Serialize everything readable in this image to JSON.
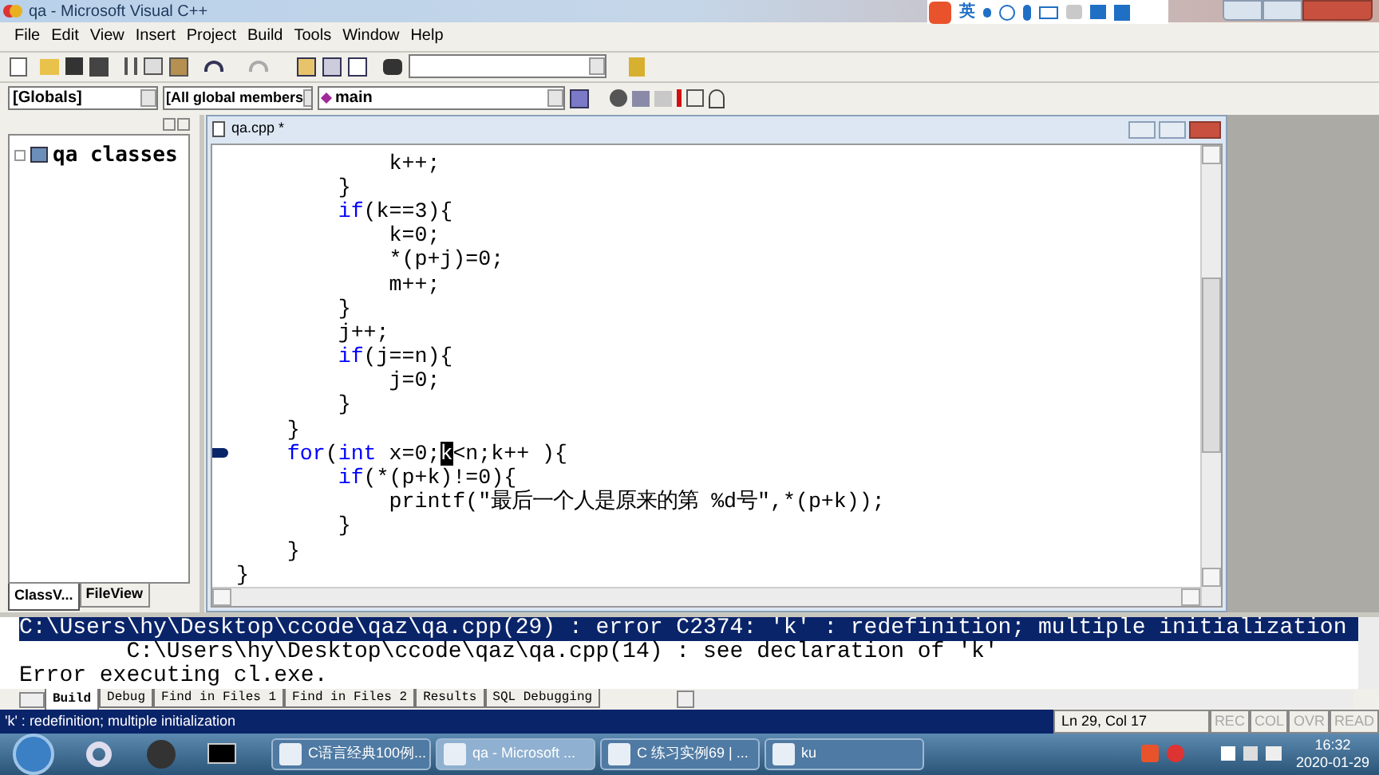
{
  "window": {
    "title": "qa - Microsoft Visual C++"
  },
  "ime_bar": {
    "label": "英"
  },
  "menu": [
    "File",
    "Edit",
    "View",
    "Insert",
    "Project",
    "Build",
    "Tools",
    "Window",
    "Help"
  ],
  "toolbar": {
    "scope_combo": {
      "value": "[Globals]"
    },
    "members_combo": {
      "value": "[All global members"
    },
    "function_combo": {
      "value": "main"
    }
  },
  "workspace": {
    "tree": [
      {
        "label": "qa classes",
        "expanded": false
      }
    ],
    "tabs": [
      {
        "label": "ClassV...",
        "selected": true
      },
      {
        "label": "FileView",
        "selected": false
      }
    ]
  },
  "editor": {
    "title": "qa.cpp *",
    "lines": [
      {
        "current": false,
        "segments": [
          {
            "kind": "text",
            "text": "            k++;"
          }
        ]
      },
      {
        "current": false,
        "segments": [
          {
            "kind": "text",
            "text": "        }"
          }
        ]
      },
      {
        "current": false,
        "segments": [
          {
            "kind": "keyword",
            "text": "        if"
          },
          {
            "kind": "text",
            "text": "(k==3){"
          }
        ]
      },
      {
        "current": false,
        "segments": [
          {
            "kind": "text",
            "text": "            k=0;"
          }
        ]
      },
      {
        "current": false,
        "segments": [
          {
            "kind": "text",
            "text": "            *(p+j)=0;"
          }
        ]
      },
      {
        "current": false,
        "segments": [
          {
            "kind": "text",
            "text": "            m++;"
          }
        ]
      },
      {
        "current": false,
        "segments": [
          {
            "kind": "text",
            "text": "        }"
          }
        ]
      },
      {
        "current": false,
        "segments": [
          {
            "kind": "text",
            "text": "        j++;"
          }
        ]
      },
      {
        "current": false,
        "segments": [
          {
            "kind": "keyword",
            "text": "        if"
          },
          {
            "kind": "text",
            "text": "(j==n){"
          }
        ]
      },
      {
        "current": false,
        "segments": [
          {
            "kind": "text",
            "text": "            j=0;"
          }
        ]
      },
      {
        "current": false,
        "segments": [
          {
            "kind": "text",
            "text": "        }"
          }
        ]
      },
      {
        "current": false,
        "segments": [
          {
            "kind": "text",
            "text": "    }"
          }
        ]
      },
      {
        "current": true,
        "segments": [
          {
            "kind": "keyword",
            "text": "    for"
          },
          {
            "kind": "text",
            "text": "("
          },
          {
            "kind": "keyword",
            "text": "int"
          },
          {
            "kind": "text",
            "text": " x=0;"
          },
          {
            "kind": "selected",
            "text": "k"
          },
          {
            "kind": "text",
            "text": "<n;k++ ){"
          }
        ]
      },
      {
        "current": false,
        "segments": [
          {
            "kind": "keyword",
            "text": "        if"
          },
          {
            "kind": "text",
            "text": "(*(p+k)!=0){"
          }
        ]
      },
      {
        "current": false,
        "segments": [
          {
            "kind": "text",
            "text": "            printf(\"最后一个人是原来的第 %d号\",*(p+k));"
          }
        ]
      },
      {
        "current": false,
        "segments": [
          {
            "kind": "text",
            "text": "        }"
          }
        ]
      },
      {
        "current": false,
        "segments": [
          {
            "kind": "text",
            "text": "    }"
          }
        ]
      },
      {
        "current": false,
        "segments": [
          {
            "kind": "text",
            "text": "}"
          }
        ]
      }
    ]
  },
  "output": {
    "lines": [
      {
        "text": "C:\\Users\\hy\\Desktop\\ccode\\qaz\\qa.cpp(29) : error C2374: 'k' : redefinition; multiple initialization",
        "selected": true
      },
      {
        "text": "        C:\\Users\\hy\\Desktop\\ccode\\qaz\\qa.cpp(14) : see declaration of 'k'",
        "selected": false
      },
      {
        "text": "Error executing cl.exe.",
        "selected": false
      }
    ],
    "tabs": [
      {
        "label": "Build",
        "selected": true
      },
      {
        "label": "Debug",
        "selected": false
      },
      {
        "label": "Find in Files 1",
        "selected": false
      },
      {
        "label": "Find in Files 2",
        "selected": false
      },
      {
        "label": "Results",
        "selected": false
      },
      {
        "label": "SQL Debugging",
        "selected": false
      }
    ]
  },
  "status_bar": {
    "message": "'k' : redefinition; multiple initialization",
    "position": "Ln 29, Col 17",
    "indicators": [
      {
        "label": "REC",
        "disabled": true
      },
      {
        "label": "COL",
        "disabled": true
      },
      {
        "label": "OVR",
        "disabled": true
      },
      {
        "label": "READ",
        "disabled": true
      }
    ]
  },
  "taskbar": {
    "tasks": [
      {
        "label": "C语言经典100例...",
        "selected": false
      },
      {
        "label": "qa - Microsoft ...",
        "selected": true
      },
      {
        "label": "C 练习实例69 | ...",
        "selected": false
      },
      {
        "label": "ku",
        "selected": false
      }
    ],
    "time": "16:32",
    "date": "2020-01-29"
  }
}
